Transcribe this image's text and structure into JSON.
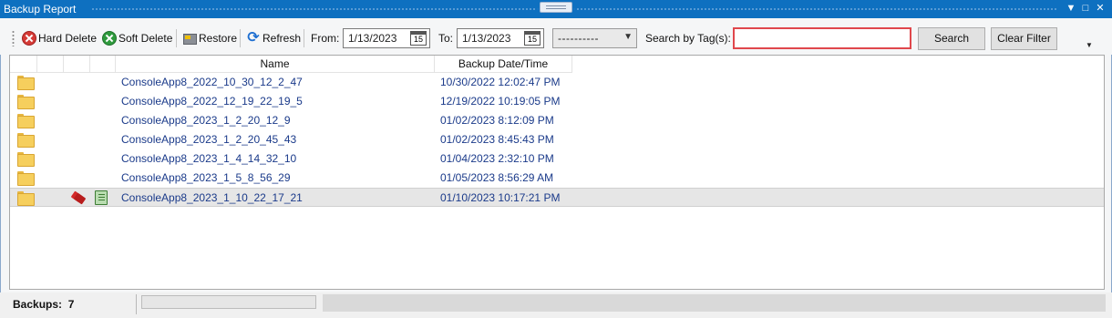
{
  "window": {
    "title": "Backup Report",
    "controls": {
      "dropdown": "▼",
      "maximize": "□",
      "close": "✕"
    }
  },
  "toolbar": {
    "hard_delete": "Hard Delete",
    "soft_delete": "Soft Delete",
    "restore": "Restore",
    "refresh": "Refresh",
    "from_label": "From:",
    "from_value": "1/13/2023",
    "to_label": "To:",
    "to_value": "1/13/2023",
    "calendar_day": "15",
    "combo_value": "----------",
    "tag_label": "Search by Tag(s):",
    "tag_value": "",
    "search": "Search",
    "clear_filter": "Clear Filter"
  },
  "grid": {
    "columns": [
      "Name",
      "Backup Date/Time"
    ],
    "rows": [
      {
        "name": "ConsoleApp8_2022_10_30_12_2_47",
        "date": "10/30/2022 12:02:47 PM",
        "tagged": false,
        "notes": false,
        "selected": false
      },
      {
        "name": "ConsoleApp8_2022_12_19_22_19_5",
        "date": "12/19/2022 10:19:05 PM",
        "tagged": false,
        "notes": false,
        "selected": false
      },
      {
        "name": "ConsoleApp8_2023_1_2_20_12_9",
        "date": "01/02/2023 8:12:09 PM",
        "tagged": false,
        "notes": false,
        "selected": false
      },
      {
        "name": "ConsoleApp8_2023_1_2_20_45_43",
        "date": "01/02/2023 8:45:43 PM",
        "tagged": false,
        "notes": false,
        "selected": false
      },
      {
        "name": "ConsoleApp8_2023_1_4_14_32_10",
        "date": "01/04/2023 2:32:10 PM",
        "tagged": false,
        "notes": false,
        "selected": false
      },
      {
        "name": "ConsoleApp8_2023_1_5_8_56_29",
        "date": "01/05/2023 8:56:29 AM",
        "tagged": false,
        "notes": false,
        "selected": false
      },
      {
        "name": "ConsoleApp8_2023_1_10_22_17_21",
        "date": "01/10/2023 10:17:21 PM",
        "tagged": true,
        "notes": true,
        "selected": true
      }
    ]
  },
  "status": {
    "backups_label": "Backups:",
    "backups_count": "7"
  },
  "colors": {
    "title_bar": "#0e70c0",
    "tag_box_border": "#e0474c",
    "link_text": "#1a3a8a"
  }
}
